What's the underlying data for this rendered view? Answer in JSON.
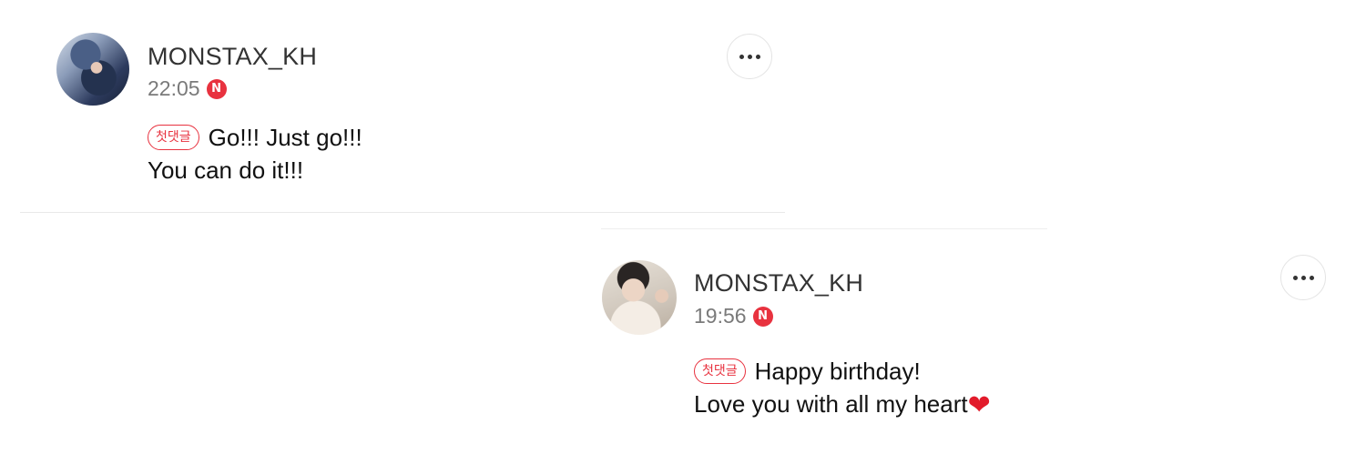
{
  "comments": [
    {
      "username": "MONSTAX_KH",
      "time": "22:05",
      "new_badge": "N",
      "first_comment_tag": "첫댓글",
      "line1": "Go!!! Just go!!!",
      "line2": "You can do it!!!",
      "more_icon": "more-horizontal-icon"
    },
    {
      "username": "MONSTAX_KH",
      "time": "19:56",
      "new_badge": "N",
      "first_comment_tag": "첫댓글",
      "line1": "Happy birthday!",
      "line2": "Love you with all my heart",
      "heart": "❤",
      "more_icon": "more-horizontal-icon"
    }
  ],
  "colors": {
    "accent_red": "#e8323f",
    "username_gray": "#333333",
    "time_gray": "#7a7a7a"
  }
}
